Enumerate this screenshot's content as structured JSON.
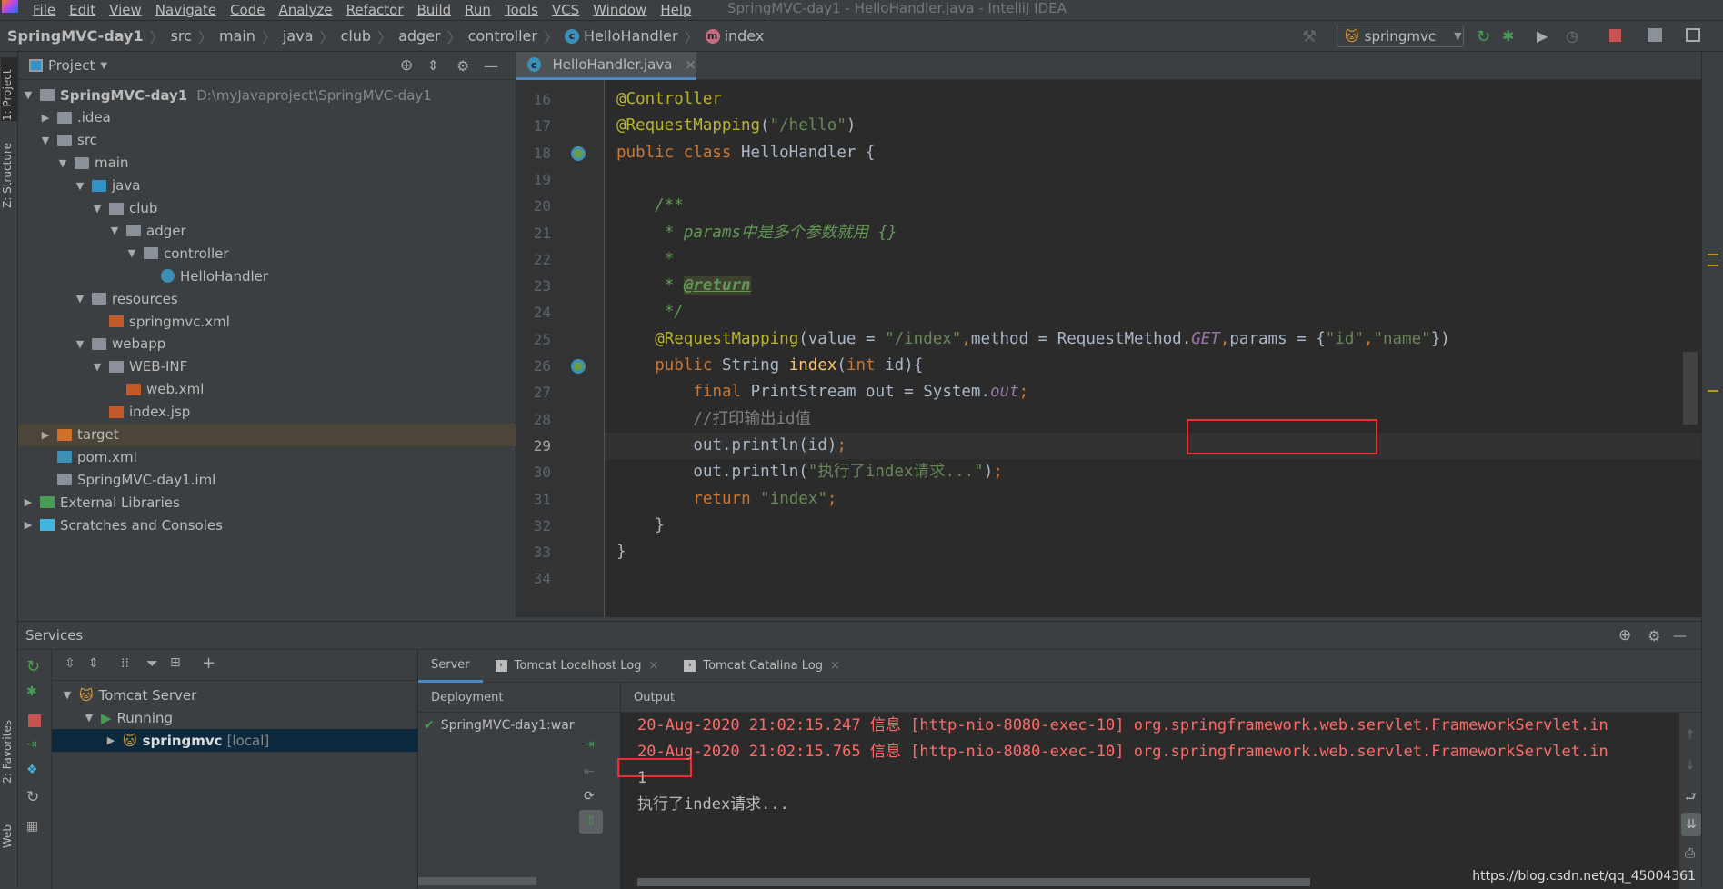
{
  "window": {
    "title": "SpringMVC-day1 - HelloHandler.java - IntelliJ IDEA"
  },
  "menu": [
    "File",
    "Edit",
    "View",
    "Navigate",
    "Code",
    "Analyze",
    "Refactor",
    "Build",
    "Run",
    "Tools",
    "VCS",
    "Window",
    "Help"
  ],
  "breadcrumb": [
    "SpringMVC-day1",
    "src",
    "main",
    "java",
    "club",
    "adger",
    "controller",
    "HelloHandler",
    "index"
  ],
  "toolbar": {
    "run_config": "springmvc",
    "stop_color": "#c75450",
    "run_color": "#499c54"
  },
  "left_stripe": {
    "project_tab": "1: Project",
    "structure_tab": "Z: Structure",
    "favorites_tab": "2: Favorites",
    "web_tab": "Web"
  },
  "project": {
    "title": "Project",
    "tree": [
      {
        "label": "SpringMVC-day1",
        "path": "D:\\myJavaproject\\SpringMVC-day1",
        "depth": 0,
        "arrow": "open",
        "icon": "module-folder-icon",
        "bold": true
      },
      {
        "label": ".idea",
        "depth": 1,
        "arrow": "closed",
        "icon": "folder-icon"
      },
      {
        "label": "src",
        "depth": 1,
        "arrow": "open",
        "icon": "folder-icon"
      },
      {
        "label": "main",
        "depth": 2,
        "arrow": "open",
        "icon": "folder-icon"
      },
      {
        "label": "java",
        "depth": 3,
        "arrow": "open",
        "icon": "source-folder-icon"
      },
      {
        "label": "club",
        "depth": 4,
        "arrow": "open",
        "icon": "package-icon"
      },
      {
        "label": "adger",
        "depth": 5,
        "arrow": "open",
        "icon": "package-icon"
      },
      {
        "label": "controller",
        "depth": 6,
        "arrow": "open",
        "icon": "package-icon"
      },
      {
        "label": "HelloHandler",
        "depth": 7,
        "arrow": "none",
        "icon": "java-class-icon"
      },
      {
        "label": "resources",
        "depth": 3,
        "arrow": "open",
        "icon": "resources-folder-icon"
      },
      {
        "label": "springmvc.xml",
        "depth": 4,
        "arrow": "none",
        "icon": "spring-xml-icon"
      },
      {
        "label": "webapp",
        "depth": 3,
        "arrow": "open",
        "icon": "web-folder-icon"
      },
      {
        "label": "WEB-INF",
        "depth": 4,
        "arrow": "open",
        "icon": "folder-icon"
      },
      {
        "label": "web.xml",
        "depth": 5,
        "arrow": "none",
        "icon": "web-xml-icon"
      },
      {
        "label": "index.jsp",
        "depth": 4,
        "arrow": "none",
        "icon": "jsp-icon"
      },
      {
        "label": "target",
        "depth": 1,
        "arrow": "closed",
        "icon": "excluded-folder-icon",
        "selected": true
      },
      {
        "label": "pom.xml",
        "depth": 1,
        "arrow": "none",
        "icon": "maven-icon"
      },
      {
        "label": "SpringMVC-day1.iml",
        "depth": 1,
        "arrow": "none",
        "icon": "iml-file-icon"
      },
      {
        "label": "External Libraries",
        "depth": 0,
        "arrow": "closed",
        "icon": "libraries-icon"
      },
      {
        "label": "Scratches and Consoles",
        "depth": 0,
        "arrow": "closed",
        "icon": "scratches-icon"
      }
    ]
  },
  "editor": {
    "tab": "HelloHandler.java",
    "current_line": 29,
    "lines": [
      {
        "n": "16",
        "indent": 0,
        "tokens": [
          [
            "@Controller",
            "ann"
          ]
        ]
      },
      {
        "n": "17",
        "indent": 0,
        "tokens": [
          [
            "@RequestMapping",
            "ann"
          ],
          [
            "(",
            ""
          ],
          [
            "\"/hello\"",
            "str"
          ],
          [
            ")",
            ""
          ]
        ]
      },
      {
        "n": "18",
        "indent": 0,
        "tokens": [
          [
            "public class ",
            "kw"
          ],
          [
            "HelloHandler {",
            ""
          ]
        ]
      },
      {
        "n": "19",
        "indent": 0,
        "tokens": []
      },
      {
        "n": "20",
        "indent": 4,
        "tokens": [
          [
            "/**",
            "doc"
          ]
        ]
      },
      {
        "n": "21",
        "indent": 5,
        "tokens": [
          [
            "* params中是多个参数就用 {}",
            "doc"
          ]
        ]
      },
      {
        "n": "22",
        "indent": 5,
        "tokens": [
          [
            "*",
            "doc"
          ]
        ]
      },
      {
        "n": "23",
        "indent": 5,
        "tokens": [
          [
            "* ",
            "doc"
          ],
          [
            "@return",
            "tag"
          ]
        ]
      },
      {
        "n": "24",
        "indent": 5,
        "tokens": [
          [
            "*/",
            "doc"
          ]
        ]
      },
      {
        "n": "25",
        "indent": 4,
        "tokens": [
          [
            "@RequestMapping",
            "ann"
          ],
          [
            "(value = ",
            ""
          ],
          [
            "\"/index\"",
            "str"
          ],
          [
            ",",
            "kw"
          ],
          [
            "method = RequestMethod.",
            ""
          ],
          [
            "GET",
            "static"
          ],
          [
            ",",
            "kw"
          ],
          [
            "params = {",
            ""
          ],
          [
            "\"id\"",
            "str"
          ],
          [
            ",",
            "kw"
          ],
          [
            "\"name\"",
            "str"
          ],
          [
            "})",
            ""
          ]
        ]
      },
      {
        "n": "26",
        "indent": 4,
        "tokens": [
          [
            "public ",
            "kw"
          ],
          [
            "String ",
            ""
          ],
          [
            "index",
            "fn"
          ],
          [
            "(",
            ""
          ],
          [
            "int ",
            "kw"
          ],
          [
            "id){",
            ""
          ]
        ]
      },
      {
        "n": "27",
        "indent": 8,
        "tokens": [
          [
            "final ",
            "kw"
          ],
          [
            "PrintStream out = System.",
            ""
          ],
          [
            "out",
            "static"
          ],
          [
            ";",
            "kw"
          ]
        ]
      },
      {
        "n": "28",
        "indent": 8,
        "tokens": [
          [
            "//打印输出id值",
            "cmt"
          ]
        ]
      },
      {
        "n": "29",
        "indent": 8,
        "tokens": [
          [
            "out.println(id)",
            ""
          ],
          [
            ";",
            "kw"
          ]
        ]
      },
      {
        "n": "30",
        "indent": 8,
        "tokens": [
          [
            "out.println(",
            ""
          ],
          [
            "\"执行了index请求...\"",
            "str"
          ],
          [
            ")",
            ""
          ],
          [
            ";",
            "kw"
          ]
        ]
      },
      {
        "n": "31",
        "indent": 8,
        "tokens": [
          [
            "return ",
            "kw"
          ],
          [
            "\"index\"",
            "str"
          ],
          [
            ";",
            "kw"
          ]
        ]
      },
      {
        "n": "32",
        "indent": 4,
        "tokens": [
          [
            "}",
            ""
          ]
        ]
      },
      {
        "n": "33",
        "indent": 0,
        "tokens": [
          [
            "}",
            ""
          ]
        ]
      },
      {
        "n": "34",
        "indent": 0,
        "tokens": []
      }
    ]
  },
  "services": {
    "title": "Services",
    "tree": [
      {
        "label": "Tomcat Server",
        "depth": 0,
        "arrow": "open",
        "icon": "tomcat-icon"
      },
      {
        "label": "Running",
        "depth": 1,
        "arrow": "open",
        "icon": "run-icon"
      },
      {
        "label": "springmvc",
        "suffix": "[local]",
        "depth": 2,
        "arrow": "closed",
        "icon": "tomcat-icon",
        "selected": true
      }
    ],
    "tabs": [
      {
        "label": "Server",
        "active": true
      },
      {
        "label": "Tomcat Localhost Log",
        "closable": true
      },
      {
        "label": "Tomcat Catalina Log",
        "closable": true
      }
    ],
    "deployment_header": "Deployment",
    "output_header": "Output",
    "deployment": [
      "SpringMVC-day1:war e"
    ],
    "output": [
      {
        "text": "20-Aug-2020 21:02:15.247 信息 [http-nio-8080-exec-10] org.springframework.web.servlet.FrameworkServlet.in",
        "color": "#ff6b68"
      },
      {
        "text": "20-Aug-2020 21:02:15.765 信息 [http-nio-8080-exec-10] org.springframework.web.servlet.FrameworkServlet.in",
        "color": "#ff6b68"
      },
      {
        "text": "1",
        "color": "#bbbbbb"
      },
      {
        "text": "执行了index请求...",
        "color": "#bbbbbb"
      }
    ]
  },
  "watermark": "https://blog.csdn.net/qq_45004361"
}
